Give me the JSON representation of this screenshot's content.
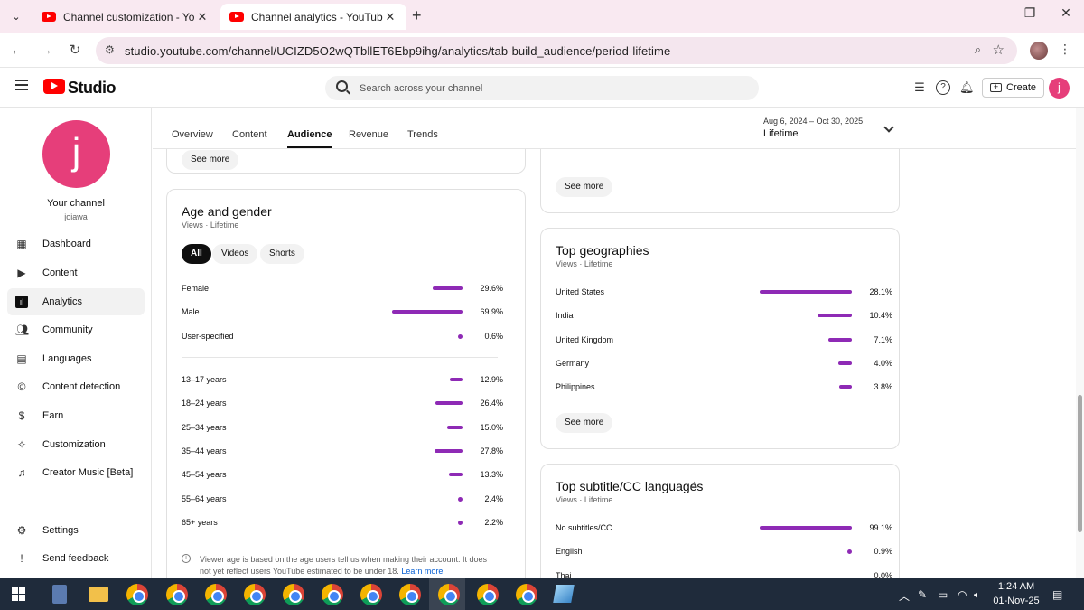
{
  "browser": {
    "tabs": [
      {
        "label": "Channel customization - YouTu",
        "active": false
      },
      {
        "label": "Channel analytics - YouTube St",
        "active": true
      }
    ],
    "url": "studio.youtube.com/channel/UCIZD5O2wQTbllET6Ebp9ihg/analytics/tab-build_audience/period-lifetime"
  },
  "header": {
    "logo_text": "Studio",
    "search_placeholder": "Search across your channel",
    "create_label": "Create",
    "avatar_letter": "j"
  },
  "channel": {
    "avatar_letter": "j",
    "name": "Your channel",
    "handle": "joiawa"
  },
  "nav": {
    "items": [
      {
        "label": "Dashboard",
        "icon": "dashboard-icon"
      },
      {
        "label": "Content",
        "icon": "content-icon"
      },
      {
        "label": "Analytics",
        "icon": "analytics-icon",
        "active": true
      },
      {
        "label": "Community",
        "icon": "community-icon"
      },
      {
        "label": "Languages",
        "icon": "languages-icon"
      },
      {
        "label": "Content detection",
        "icon": "copyright-icon"
      },
      {
        "label": "Earn",
        "icon": "dollar-icon"
      },
      {
        "label": "Customization",
        "icon": "magic-wand-icon"
      },
      {
        "label": "Creator Music [Beta]",
        "icon": "music-icon"
      }
    ],
    "settings": "Settings",
    "feedback": "Send feedback"
  },
  "analytics": {
    "tabs": [
      "Overview",
      "Content",
      "Audience",
      "Revenue",
      "Trends"
    ],
    "active_tab": "Audience",
    "period_range": "Aug 6, 2024 – Oct 30, 2025",
    "period_label": "Lifetime"
  },
  "cards": {
    "see_more": "See more",
    "age_gender": {
      "title": "Age and gender",
      "subtitle": "Views · Lifetime",
      "filters": [
        "All",
        "Videos",
        "Shorts"
      ],
      "gender": [
        {
          "label": "Female",
          "value": "29.6%",
          "pct": 29.6
        },
        {
          "label": "Male",
          "value": "69.9%",
          "pct": 69.9
        },
        {
          "label": "User-specified",
          "value": "0.6%",
          "pct": 0.6
        }
      ],
      "age": [
        {
          "label": "13–17 years",
          "value": "12.9%",
          "pct": 12.9
        },
        {
          "label": "18–24 years",
          "value": "26.4%",
          "pct": 26.4
        },
        {
          "label": "25–34 years",
          "value": "15.0%",
          "pct": 15.0
        },
        {
          "label": "35–44 years",
          "value": "27.8%",
          "pct": 27.8
        },
        {
          "label": "45–54 years",
          "value": "13.3%",
          "pct": 13.3
        },
        {
          "label": "55–64 years",
          "value": "2.4%",
          "pct": 2.4
        },
        {
          "label": "65+ years",
          "value": "2.2%",
          "pct": 2.2
        }
      ],
      "note": "Viewer age is based on the age users tell us when making their account. It does not yet reflect users YouTube estimated to be under 18.",
      "learn_more": "Learn more"
    },
    "geographies": {
      "title": "Top geographies",
      "subtitle": "Views · Lifetime",
      "rows": [
        {
          "label": "United States",
          "value": "28.1%",
          "pct": 28.1
        },
        {
          "label": "India",
          "value": "10.4%",
          "pct": 10.4
        },
        {
          "label": "United Kingdom",
          "value": "7.1%",
          "pct": 7.1
        },
        {
          "label": "Germany",
          "value": "4.0%",
          "pct": 4.0
        },
        {
          "label": "Philippines",
          "value": "3.8%",
          "pct": 3.8
        }
      ]
    },
    "subtitles": {
      "title": "Top subtitle/CC languages",
      "subtitle": "Views · Lifetime",
      "rows": [
        {
          "label": "No subtitles/CC",
          "value": "99.1%",
          "pct": 99.1
        },
        {
          "label": "English",
          "value": "0.9%",
          "pct": 0.9
        },
        {
          "label": "Thai",
          "value": "0.0%",
          "pct": 0.0
        }
      ]
    }
  },
  "taskbar": {
    "time": "1:24 AM",
    "date": "01-Nov-25"
  },
  "colors": {
    "bar": "#8e2ab5",
    "brand_red": "#ff0000",
    "avatar_pink": "#e63e7a"
  }
}
